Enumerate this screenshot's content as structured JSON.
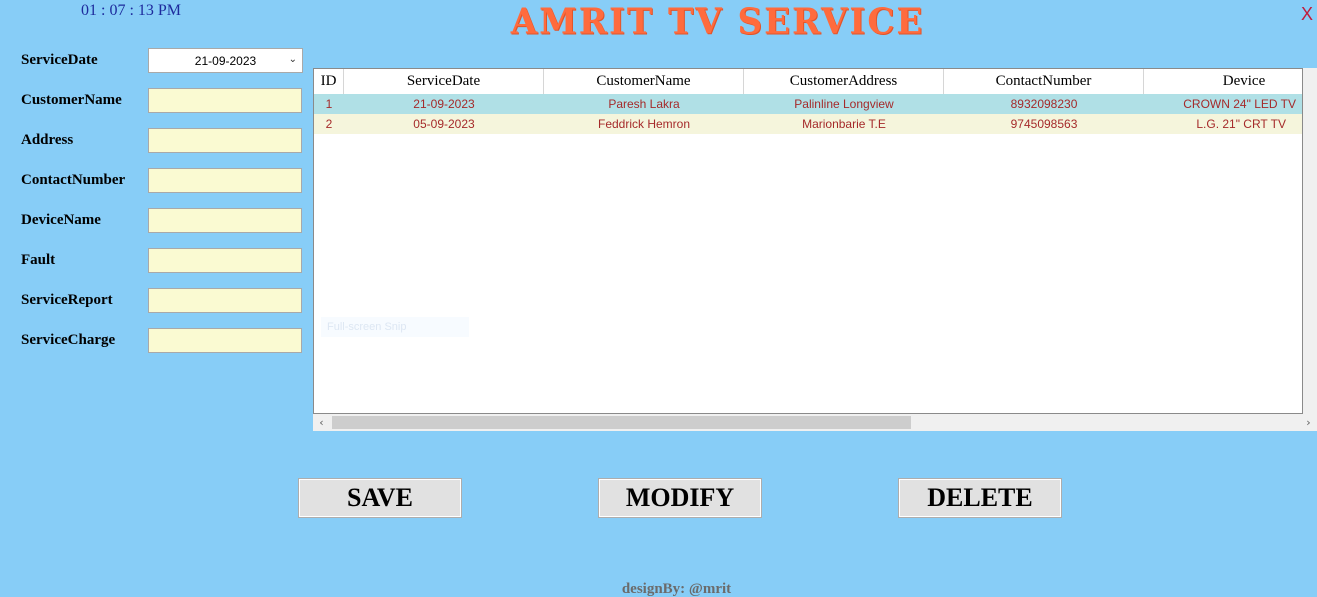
{
  "clock": "01 : 07 : 13 PM",
  "title": "AMRIT TV SERVICE",
  "close_label": "X",
  "form": {
    "service_date": {
      "label": "ServiceDate",
      "value": "21-09-2023"
    },
    "customer_name": {
      "label": "CustomerName",
      "value": ""
    },
    "address": {
      "label": "Address",
      "value": ""
    },
    "contact_number": {
      "label": "ContactNumber",
      "value": ""
    },
    "device_name": {
      "label": "DeviceName",
      "value": ""
    },
    "fault": {
      "label": "Fault",
      "value": ""
    },
    "service_report": {
      "label": "ServiceReport",
      "value": ""
    },
    "service_charge": {
      "label": "ServiceCharge",
      "value": ""
    }
  },
  "grid": {
    "columns": [
      "ID",
      "ServiceDate",
      "CustomerName",
      "CustomerAddress",
      "ContactNumber",
      "Device"
    ],
    "rows": [
      [
        "1",
        "21-09-2023",
        "Paresh Lakra",
        "Palinline Longview",
        "8932098230",
        "CROWN 24\" LED TV"
      ],
      [
        "2",
        "05-09-2023",
        "Feddrick Hemron",
        "Marionbarie T.E",
        "9745098563",
        "L.G. 21\" CRT TV"
      ]
    ],
    "hint": "Full-screen Snip"
  },
  "buttons": {
    "save": "SAVE",
    "modify": "MODIFY",
    "delete": "DELETE"
  },
  "footer": "designBy: @mrit",
  "colors": {
    "background": "#87cdf7",
    "title": "#ff6b3d",
    "input_bg": "#fafad2",
    "row_selected": "#b0e0e6",
    "row_alt": "#f5f5dc",
    "cell_text": "#a52a2a"
  }
}
